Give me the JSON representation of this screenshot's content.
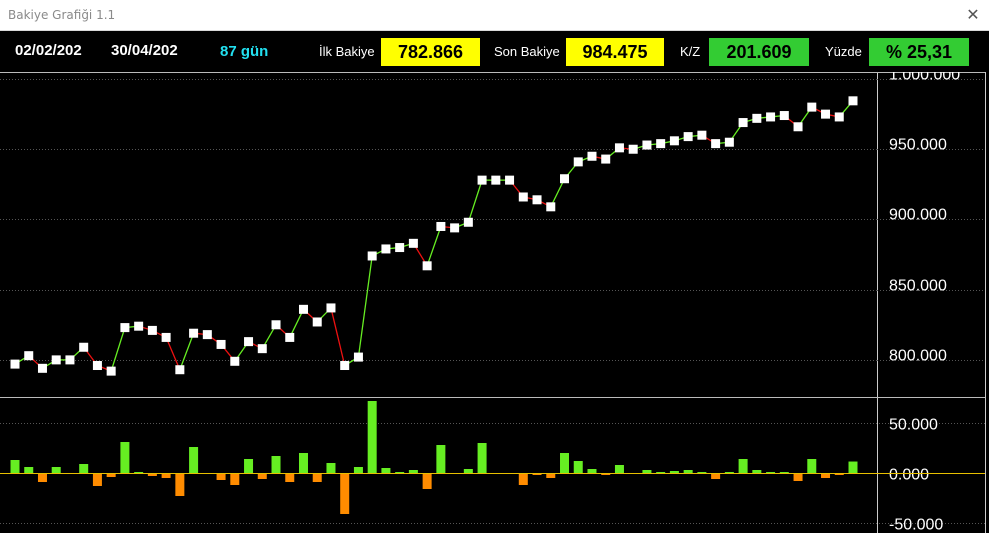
{
  "window": {
    "title": "Bakiye Grafiği 1.1",
    "close_glyph": "✕"
  },
  "header": {
    "start_date": "02/02/202",
    "end_date": "30/04/202",
    "days": "87 gün",
    "initial_balance_label": "İlk Bakiye",
    "initial_balance": "782.866",
    "final_balance_label": "Son Bakiye",
    "final_balance": "984.475",
    "pl_label": "K/Z",
    "pl": "201.609",
    "percent_label": "Yüzde",
    "percent": "% 25,31"
  },
  "colors": {
    "up_line": "#66ee22",
    "down_line": "#ee1111",
    "positive_bar": "#66ee22",
    "negative_bar": "#ff8c00",
    "zero_line": "#e8c000",
    "grid": "#555555",
    "highlight_yellow": "#ffff00",
    "highlight_green": "#33cc33"
  },
  "chart_data": [
    {
      "type": "line",
      "ylim": [
        775000,
        1005000
      ],
      "y_ticks": [
        "1.000.000",
        "950.000",
        "900.000",
        "850.000",
        "800.000"
      ],
      "y_tick_values": [
        1000000,
        950000,
        900000,
        850000,
        800000
      ],
      "series": [
        {
          "values": [
            797000,
            803000,
            794000,
            800000,
            800000,
            809000,
            796000,
            792000,
            823000,
            824000,
            821000,
            816000,
            793000,
            819000,
            818000,
            811000,
            799000,
            813000,
            808000,
            825000,
            816000,
            836000,
            827000,
            837000,
            796000,
            802000,
            874000,
            879000,
            880000,
            883000,
            867000,
            895000,
            894000,
            898000,
            928000,
            928000,
            928000,
            916000,
            914000,
            909000,
            929000,
            941000,
            945000,
            943000,
            951000,
            950000,
            953000,
            954000,
            956000,
            959000,
            960000,
            954000,
            955000,
            969000,
            972000,
            973000,
            974000,
            966000,
            980000,
            975000,
            973000,
            984475
          ]
        }
      ]
    },
    {
      "type": "bar",
      "ylim": [
        -60000,
        75000
      ],
      "y_ticks": [
        "50.000",
        "0.000",
        "-50.000"
      ],
      "y_tick_values": [
        50000,
        0,
        -50000
      ],
      "values": [
        13000,
        6000,
        -9000,
        6000,
        0,
        9000,
        -13000,
        -4000,
        31000,
        1000,
        -3000,
        -5000,
        -23000,
        26000,
        -1000,
        -7000,
        -12000,
        14000,
        -6000,
        17000,
        -9000,
        20000,
        -9000,
        10000,
        -41000,
        6000,
        72000,
        5000,
        1000,
        3000,
        -16000,
        28000,
        -1000,
        4000,
        30000,
        0,
        0,
        -12000,
        -2000,
        -5000,
        20000,
        12000,
        4000,
        -2000,
        8000,
        -1000,
        3000,
        1000,
        2000,
        3000,
        1000,
        -6000,
        1000,
        14000,
        3000,
        1000,
        1000,
        -8000,
        14000,
        -5000,
        -2000,
        11475
      ]
    }
  ]
}
